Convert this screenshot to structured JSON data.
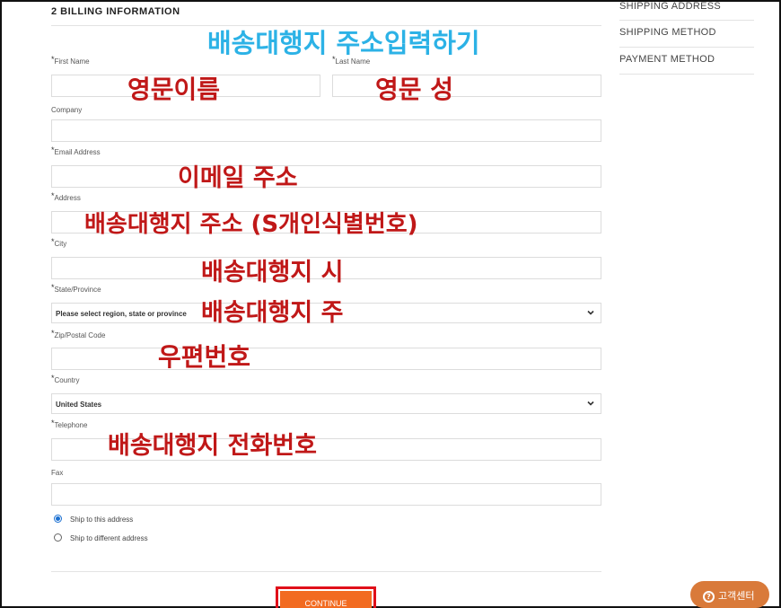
{
  "section": {
    "title": "2  BILLING INFORMATION"
  },
  "sidebar": {
    "items": [
      {
        "label": "SHIPPING ADDRESS"
      },
      {
        "label": "SHIPPING METHOD"
      },
      {
        "label": "PAYMENT METHOD"
      }
    ]
  },
  "form": {
    "required_mark": "*",
    "first_name_label": "First Name",
    "last_name_label": "Last Name",
    "company_label": "Company",
    "email_label": "Email Address",
    "address_label": "Address",
    "city_label": "City",
    "state_label": "State/Province",
    "state_value": "Please select region, state or province",
    "zip_label": "Zip/Postal Code",
    "country_label": "Country",
    "country_value": "United States",
    "telephone_label": "Telephone",
    "fax_label": "Fax",
    "ship_this_label": "Ship to this address",
    "ship_diff_label": "Ship to different address",
    "ship_selected": "this",
    "continue_label": "CONTINUE"
  },
  "annotations": {
    "header": "배송대행지 주소입력하기",
    "first_name": "영문이름",
    "last_name": "영문 성",
    "email": "이메일 주소",
    "address": "배송대행지 주소  (S개인식별번호)",
    "city": "배송대행지 시",
    "state": "배송대행지 주",
    "zip": "우편번호",
    "telephone": "배송대행지 전화번호"
  },
  "help": {
    "label": "고객센터",
    "icon": "question-icon"
  },
  "colors": {
    "annotation_red": "#c01818",
    "annotation_blue": "#2cb2e6",
    "button_orange": "#f26b21",
    "button_highlight": "#e0101a",
    "help_bg": "#d97a3a",
    "radio_selected": "#1a6fd1"
  }
}
